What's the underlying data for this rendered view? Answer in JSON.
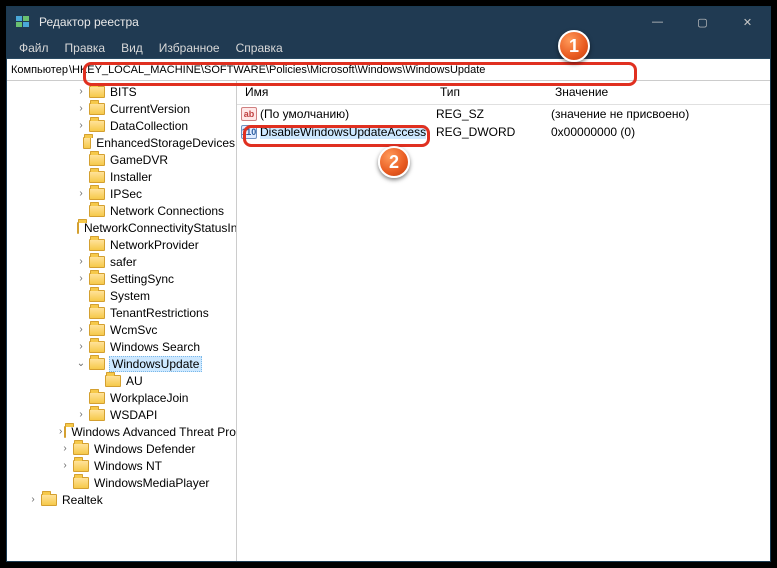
{
  "window": {
    "title": "Редактор реестра"
  },
  "win_controls": {
    "min": "—",
    "max": "▢",
    "close": "✕"
  },
  "menu": {
    "file": "Файл",
    "edit": "Правка",
    "view": "Вид",
    "favorites": "Избранное",
    "help": "Справка"
  },
  "address": {
    "label": "Компьютер",
    "path": "\\HKEY_LOCAL_MACHINE\\SOFTWARE\\Policies\\Microsoft\\Windows\\WindowsUpdate"
  },
  "columns": {
    "name": "Имя",
    "type": "Тип",
    "value": "Значение"
  },
  "tree": [
    {
      "indent": 4,
      "expander": ">",
      "label": "BITS"
    },
    {
      "indent": 4,
      "expander": ">",
      "label": "CurrentVersion"
    },
    {
      "indent": 4,
      "expander": ">",
      "label": "DataCollection"
    },
    {
      "indent": 4,
      "expander": "",
      "label": "EnhancedStorageDevices"
    },
    {
      "indent": 4,
      "expander": "",
      "label": "GameDVR"
    },
    {
      "indent": 4,
      "expander": "",
      "label": "Installer"
    },
    {
      "indent": 4,
      "expander": ">",
      "label": "IPSec"
    },
    {
      "indent": 4,
      "expander": "",
      "label": "Network Connections"
    },
    {
      "indent": 4,
      "expander": "",
      "label": "NetworkConnectivityStatusIndicator"
    },
    {
      "indent": 4,
      "expander": "",
      "label": "NetworkProvider"
    },
    {
      "indent": 4,
      "expander": ">",
      "label": "safer"
    },
    {
      "indent": 4,
      "expander": ">",
      "label": "SettingSync"
    },
    {
      "indent": 4,
      "expander": "",
      "label": "System"
    },
    {
      "indent": 4,
      "expander": "",
      "label": "TenantRestrictions"
    },
    {
      "indent": 4,
      "expander": ">",
      "label": "WcmSvc"
    },
    {
      "indent": 4,
      "expander": ">",
      "label": "Windows Search"
    },
    {
      "indent": 4,
      "expander": "v",
      "label": "WindowsUpdate",
      "selected": true
    },
    {
      "indent": 5,
      "expander": "",
      "label": "AU"
    },
    {
      "indent": 4,
      "expander": "",
      "label": "WorkplaceJoin"
    },
    {
      "indent": 4,
      "expander": ">",
      "label": "WSDAPI"
    },
    {
      "indent": 3,
      "expander": ">",
      "label": "Windows Advanced Threat Protection"
    },
    {
      "indent": 3,
      "expander": ">",
      "label": "Windows Defender"
    },
    {
      "indent": 3,
      "expander": ">",
      "label": "Windows NT"
    },
    {
      "indent": 3,
      "expander": "",
      "label": "WindowsMediaPlayer"
    },
    {
      "indent": 1,
      "expander": ">",
      "label": "Realtek"
    }
  ],
  "values": [
    {
      "icon": "str",
      "icon_txt": "ab",
      "name": "(По умолчанию)",
      "type": "REG_SZ",
      "data": "(значение не присвоено)",
      "selected": false
    },
    {
      "icon": "dw",
      "icon_txt": "110",
      "name": "DisableWindowsUpdateAccess",
      "type": "REG_DWORD",
      "data": "0x00000000 (0)",
      "selected": true
    }
  ],
  "annotations": {
    "badge1": "1",
    "badge2": "2"
  }
}
